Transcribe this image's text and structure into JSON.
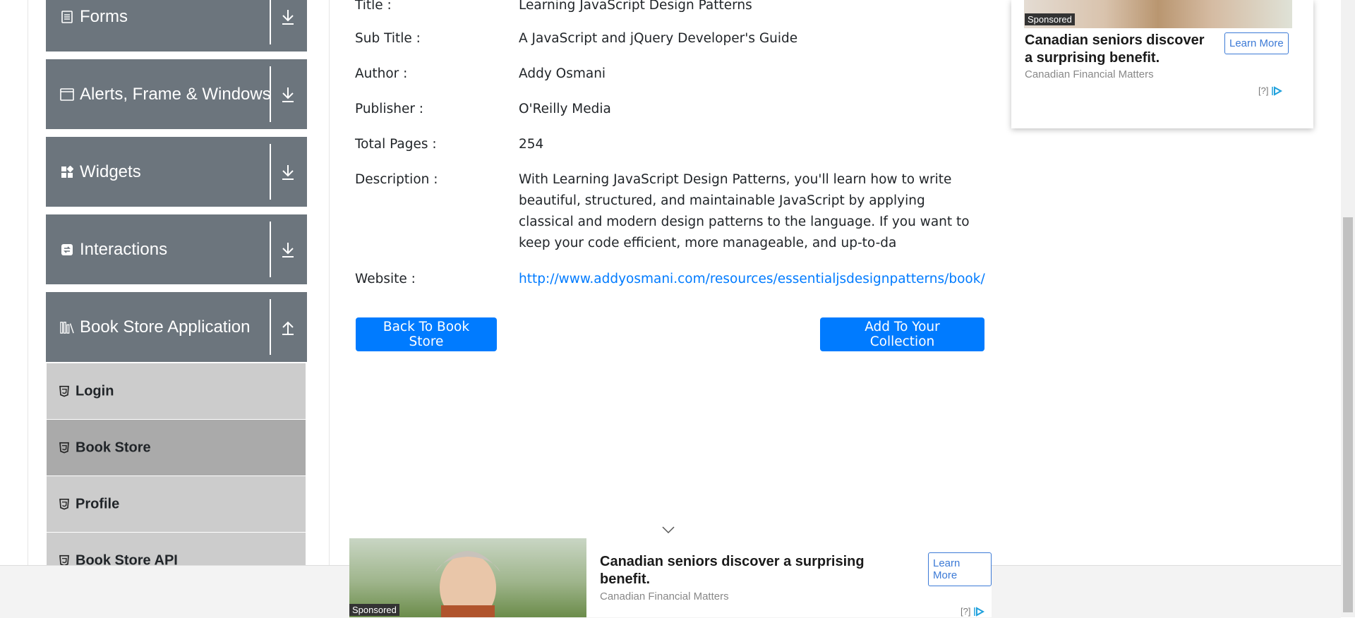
{
  "sidebar": {
    "groups": [
      {
        "label": "Forms",
        "icon": "document-icon",
        "toggle": "download-arrow-icon"
      },
      {
        "label": "Alerts, Frame & Windows",
        "icon": "window-icon",
        "toggle": "download-arrow-icon"
      },
      {
        "label": "Widgets",
        "icon": "widgets-icon",
        "toggle": "download-arrow-icon"
      },
      {
        "label": "Interactions",
        "icon": "interactions-icon",
        "toggle": "download-arrow-icon"
      },
      {
        "label": "Book Store Application",
        "icon": "books-icon",
        "toggle": "upload-arrow-icon"
      }
    ],
    "items": [
      {
        "label": "Login",
        "icon": "html5-icon"
      },
      {
        "label": "Book Store",
        "icon": "html5-icon",
        "active": true
      },
      {
        "label": "Profile",
        "icon": "html5-icon"
      },
      {
        "label": "Book Store API",
        "icon": "html5-icon"
      }
    ]
  },
  "book": {
    "title_label": "Title :",
    "title_value": "Learning JavaScript Design Patterns",
    "subtitle_label": "Sub Title :",
    "subtitle_value": "A JavaScript and jQuery Developer's Guide",
    "author_label": "Author :",
    "author_value": "Addy Osmani",
    "publisher_label": "Publisher :",
    "publisher_value": "O'Reilly Media",
    "pages_label": "Total Pages :",
    "pages_value": "254",
    "description_label": "Description :",
    "description_value": "With Learning JavaScript Design Patterns, you'll learn how to write beautiful, structured, and maintainable JavaScript by applying classical and modern design patterns to the language. If you want to keep your code efficient, more manageable, and up-to-da",
    "website_label": "Website :",
    "website_value": "http://www.addyosmani.com/resources/essentialjsdesignpatterns/book/"
  },
  "actions": {
    "back_label": "Back To Book Store",
    "add_label": "Add To Your Collection"
  },
  "ads": {
    "sponsored": "Sponsored",
    "title": "Canadian seniors discover a surprising benefit.",
    "source": "Canadian Financial Matters",
    "learn_more": "Learn More",
    "adchoice": "[?]"
  },
  "colors": {
    "sidebar_header": "#6c757d",
    "menu_item": "#cccccc",
    "menu_item_active": "#aaaaaa",
    "primary": "#007bff"
  }
}
